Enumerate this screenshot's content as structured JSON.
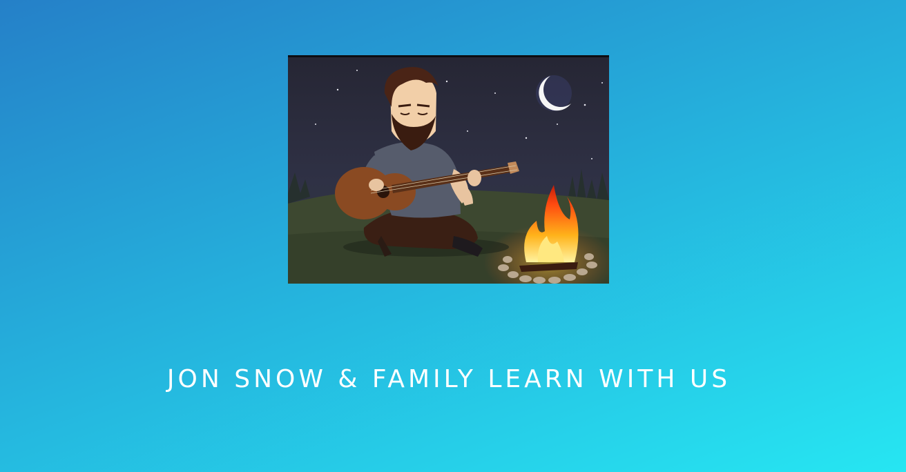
{
  "hero": {
    "illustration": "bearded-man-playing-guitar-by-campfire",
    "colors": {
      "sky": "#2b2b3d",
      "ground": "#3f4a30",
      "fire": "#ff5a1a",
      "guitar": "#8a4a22"
    }
  },
  "headline": {
    "text": "JON SNOW & FAMILY LEARN WITH US"
  },
  "colors": {
    "gradient_start": "#2580c8",
    "gradient_end": "#26e6f2",
    "text": "#ffffff"
  }
}
